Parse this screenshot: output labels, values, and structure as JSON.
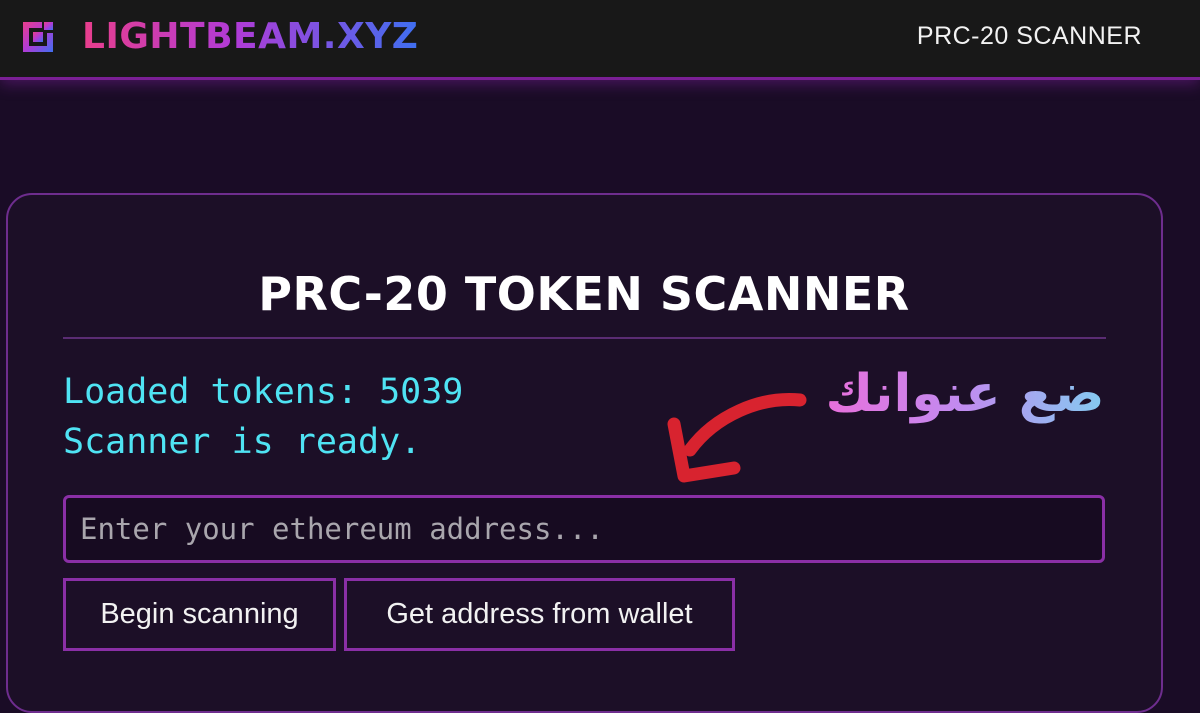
{
  "navbar": {
    "brand": "LIGHTBEAM.XYZ",
    "nav_link": "PRC-20 SCANNER"
  },
  "card": {
    "title": "PRC-20 TOKEN SCANNER",
    "status_lines": [
      "Loaded tokens: 5039",
      "Scanner is ready."
    ],
    "address_input": {
      "placeholder": "Enter your ethereum address...",
      "value": ""
    },
    "buttons": {
      "begin_label": "Begin scanning",
      "wallet_label": "Get address from wallet"
    }
  },
  "overlay": {
    "annotation_text": "ضع عنوانك",
    "arrow_color": "#d8232f"
  },
  "colors": {
    "accent": "#8a2fa6",
    "status_text": "#4fe3f3",
    "background": "#1a0c26",
    "navbar_bg": "#181818"
  }
}
